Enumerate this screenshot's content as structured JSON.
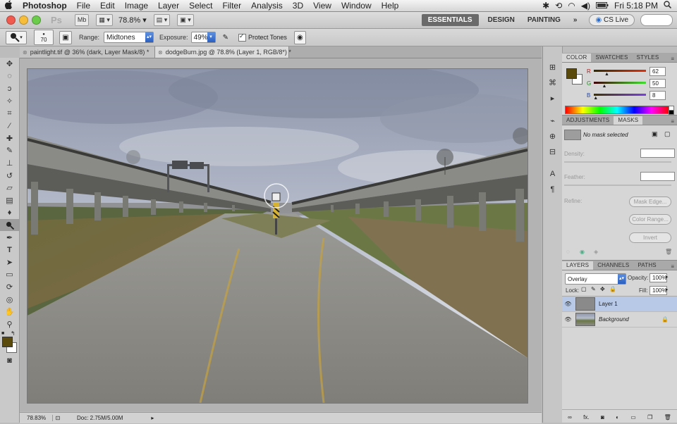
{
  "menubar": {
    "app_name": "Photoshop",
    "items": [
      "File",
      "Edit",
      "Image",
      "Layer",
      "Select",
      "Filter",
      "Analysis",
      "3D",
      "View",
      "Window",
      "Help"
    ],
    "clock": "Fri 5:18 PM"
  },
  "appbar": {
    "logo": "Ps",
    "mb_label": "Mb",
    "zoom": "78.8%",
    "workspaces": [
      "ESSENTIALS",
      "DESIGN",
      "PAINTING"
    ],
    "more": "»",
    "cs_live": "CS Live"
  },
  "options": {
    "brush_size": "70",
    "range_label": "Range:",
    "range_value": "Midtones",
    "exposure_label": "Exposure:",
    "exposure_value": "49%",
    "protect_tones_label": "Protect Tones",
    "protect_tones_checked": true
  },
  "tabs": [
    {
      "label": "paintlight.tif @ 36% (dark, Layer Mask/8) *",
      "active": false
    },
    {
      "label": "dodgeBurn.jpg @ 78.8% (Layer 1, RGB/8*) *",
      "active": true
    }
  ],
  "status": {
    "zoom": "78.83%",
    "doc": "Doc: 2.75M/5.00M"
  },
  "color_panel": {
    "tabs": [
      "COLOR",
      "SWATCHES",
      "STYLES"
    ],
    "foreground": "#5a4a0c",
    "r_label": "R",
    "r_value": "62",
    "r_fraction": 0.243,
    "g_label": "G",
    "g_value": "50",
    "g_fraction": 0.196,
    "b_label": "B",
    "b_value": "8",
    "b_fraction": 0.031
  },
  "adjust_panel": {
    "tabs": [
      "ADJUSTMENTS",
      "MASKS"
    ],
    "no_mask": "No mask selected",
    "density": "Density:",
    "feather": "Feather:",
    "refine": "Refine:",
    "mask_edge": "Mask Edge...",
    "color_range": "Color Range...",
    "invert": "Invert"
  },
  "layers_panel": {
    "tabs": [
      "LAYERS",
      "CHANNELS",
      "PATHS"
    ],
    "blend_mode": "Overlay",
    "opacity_label": "Opacity:",
    "opacity_value": "100%",
    "lock_label": "Lock:",
    "fill_label": "Fill:",
    "fill_value": "100%",
    "layers": [
      {
        "name": "Layer 1",
        "active": true
      },
      {
        "name": "Background",
        "active": false
      }
    ],
    "footer_link": "fx."
  },
  "icons": {
    "apple": "apple-icon",
    "search": "spotlight-icon"
  }
}
